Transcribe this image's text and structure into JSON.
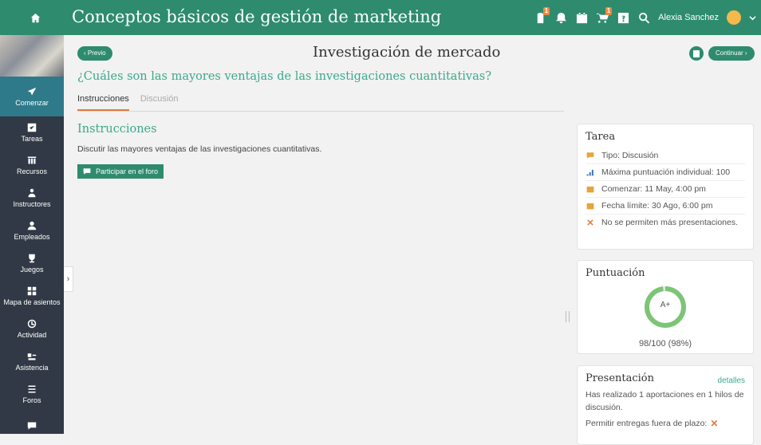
{
  "header": {
    "title": "Conceptos básicos de gestión de marketing",
    "badges": {
      "assignments": "1",
      "cart": "1"
    },
    "user_name": "Alexia Sanchez"
  },
  "sidebar": {
    "items": [
      {
        "label": "Comenzar",
        "icon": "paper-plane-icon",
        "active": true
      },
      {
        "label": "Tareas",
        "icon": "check-square-icon"
      },
      {
        "label": "Recursos",
        "icon": "library-icon"
      },
      {
        "label": "Instructores",
        "icon": "instructors-icon"
      },
      {
        "label": "Empleados",
        "icon": "user-icon"
      },
      {
        "label": "Juegos",
        "icon": "trophy-icon"
      },
      {
        "label": "Mapa de asientos",
        "icon": "grid-icon"
      },
      {
        "label": "Actividad",
        "icon": "clock-icon"
      },
      {
        "label": "Asistencia",
        "icon": "attendance-icon"
      },
      {
        "label": "Foros",
        "icon": "list-icon"
      },
      {
        "label": "",
        "icon": "chat-icon"
      }
    ]
  },
  "main": {
    "prev_label": "Previo",
    "next_label": "Continuar",
    "page_title": "Investigación de mercado",
    "question": "¿Cuáles son las mayores ventajas de las investigaciones cuantitativas?",
    "tabs": [
      "Instrucciones",
      "Discusión"
    ],
    "section_title": "Instrucciones",
    "description": "Discutir las mayores ventajas de las investigaciones cuantitativas.",
    "forum_button": "Participar en el foro"
  },
  "task_card": {
    "title": "Tarea",
    "rows": [
      {
        "icon": "chat-icon",
        "text": "Tipo: Discusión"
      },
      {
        "icon": "signal-icon",
        "text": "Máxima puntuación individual: 100"
      },
      {
        "icon": "calendar-icon",
        "text": "Comenzar: 11 May, 4:00 pm"
      },
      {
        "icon": "calendar-icon",
        "text": "Fecha límite: 30 Ago, 6:00 pm"
      },
      {
        "icon": "x-icon",
        "text": "No se permiten más presentaciones."
      }
    ]
  },
  "score_card": {
    "title": "Puntuación",
    "grade": "A+",
    "score_text": "98/100 (98%)",
    "fraction": 0.98
  },
  "presentation_card": {
    "title": "Presentación",
    "details_link": "detalles",
    "text": "Has realizado 1 aportaciones en 1 hilos de discusión.",
    "late_label": "Permitir entregas fuera de plazo:"
  },
  "colors": {
    "primary": "#2e8b6e",
    "accent": "#e07b39",
    "sidebar": "#303945",
    "link": "#3ba98a"
  }
}
